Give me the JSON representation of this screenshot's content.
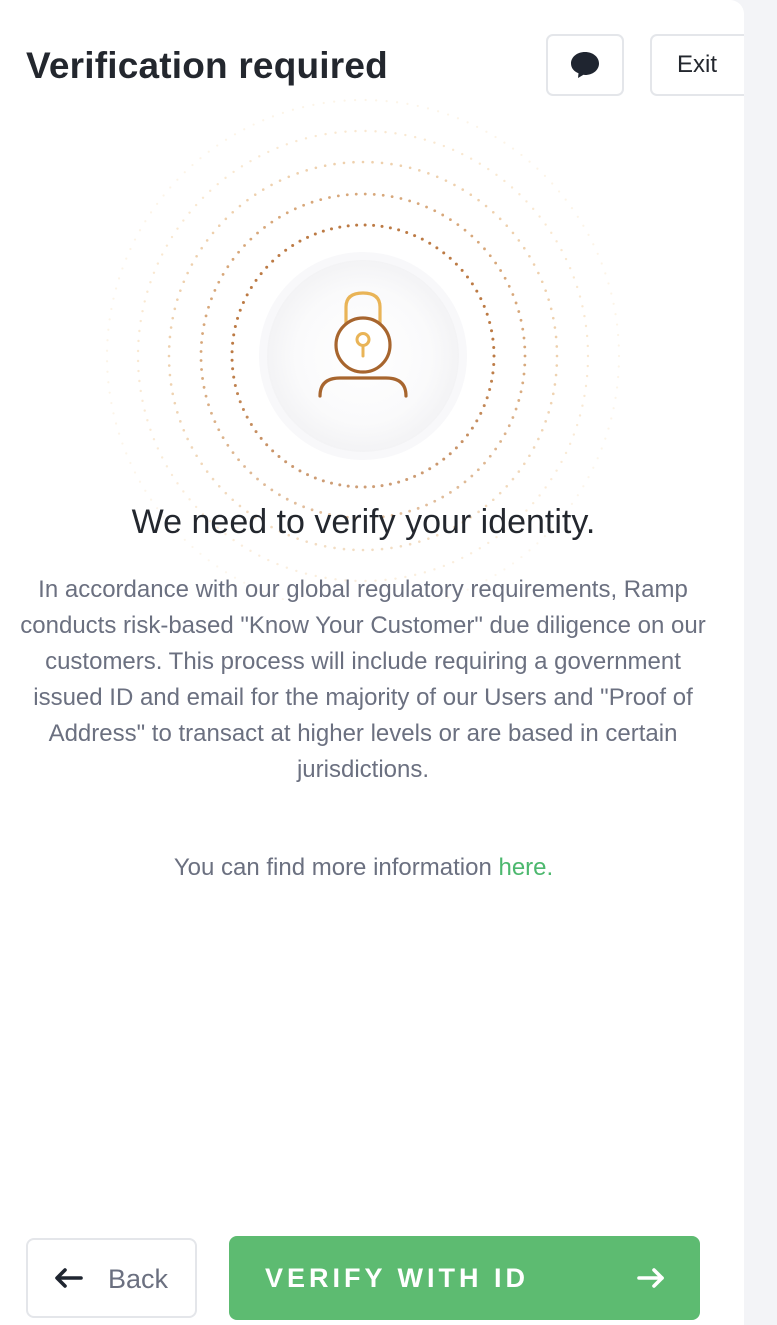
{
  "header": {
    "title": "Verification required",
    "chat_icon": "chat-bubble-icon",
    "exit_label": "Exit"
  },
  "illustration": {
    "icon": "locked-user-icon",
    "colors": {
      "ring_inner": "#b8733a",
      "ring_outer": "#f0c98a",
      "lock_shackle": "#e9b457",
      "lock_body": "#a7652e"
    }
  },
  "content": {
    "heading": "We need to verify your identity.",
    "body": "In accordance with our global regulatory requirements, Ramp conducts risk-based \"Know Your Customer\" due diligence on our customers. This process will include requiring a government issued ID and email for the majority of our Users and \"Proof of Address\" to transact at higher levels or are based in certain jurisdictions.",
    "info_prefix": "You can find more information ",
    "info_link": "here."
  },
  "footer": {
    "back_label": "Back",
    "back_icon": "arrow-left-icon",
    "verify_label": "VERIFY WITH ID",
    "verify_icon": "arrow-right-icon"
  },
  "colors": {
    "accent": "#5dbb71",
    "link": "#4cb86e",
    "text_primary": "#23272e",
    "text_secondary": "#6b7080"
  }
}
